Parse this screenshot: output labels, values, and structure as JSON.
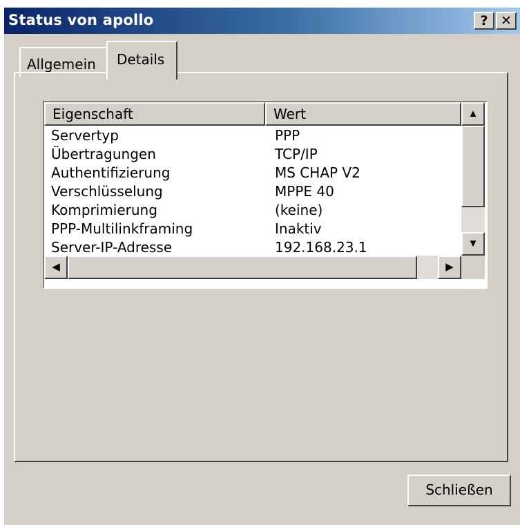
{
  "window": {
    "title": "Status von apollo",
    "help_button": "?",
    "close_button": "✕"
  },
  "tabs": [
    {
      "label": "Allgemein",
      "active": false
    },
    {
      "label": "Details",
      "active": true
    }
  ],
  "list": {
    "columns": [
      "Eigenschaft",
      "Wert"
    ],
    "rows": [
      [
        "Servertyp",
        "PPP"
      ],
      [
        "Übertragungen",
        "TCP/IP"
      ],
      [
        "Authentifizierung",
        "MS CHAP V2"
      ],
      [
        "Verschlüsselung",
        "MPPE 40"
      ],
      [
        "Komprimierung",
        "(keine)"
      ],
      [
        "PPP-Multilinkframing",
        "Inaktiv"
      ],
      [
        "Server-IP-Adresse",
        "192.168.23.1"
      ]
    ]
  },
  "scrollbar_icons": {
    "up": "▲",
    "down": "▼",
    "left": "◀",
    "right": "▶"
  },
  "footer": {
    "close_label": "Schließen"
  }
}
